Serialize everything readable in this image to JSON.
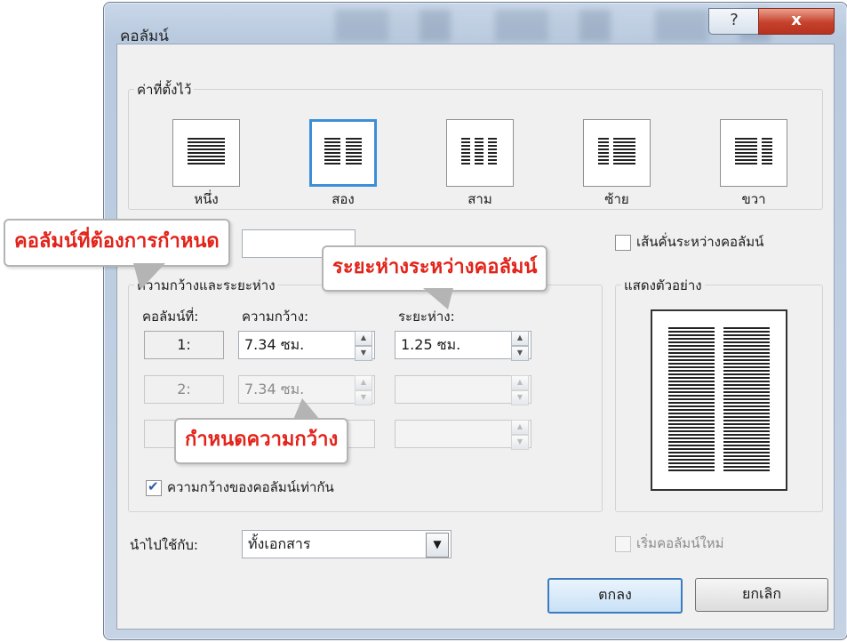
{
  "dialog": {
    "title": "คอลัมน์",
    "help_label": "?",
    "close_label": "x"
  },
  "presets": {
    "legend": "ค่าที่ตั้งไว้",
    "items": [
      {
        "label": "หนึ่ง",
        "icon": "one-column-icon",
        "selected": false
      },
      {
        "label": "สอง",
        "icon": "two-columns-icon",
        "selected": true
      },
      {
        "label": "สาม",
        "icon": "three-columns-icon",
        "selected": false
      },
      {
        "label": "ซ้าย",
        "icon": "left-column-icon",
        "selected": false
      },
      {
        "label": "ขวา",
        "icon": "right-column-icon",
        "selected": false
      }
    ]
  },
  "line_between": {
    "label": "เส้นคั่นระหว่างคอลัมน์",
    "checked": false
  },
  "width_spacing": {
    "legend": "ความกว้างและระยะห่าง",
    "headers": {
      "column": "คอลัมน์ที่:",
      "width": "ความกว้าง:",
      "spacing": "ระยะห่าง:"
    },
    "rows": [
      {
        "num": "1:",
        "width": "7.34 ซม.",
        "spacing": "1.25 ซม.",
        "enabled": true
      },
      {
        "num": "2:",
        "width": "7.34 ซม.",
        "spacing": "",
        "enabled": false
      },
      {
        "num": "",
        "width": "",
        "spacing": "",
        "enabled": false
      }
    ],
    "equal_width": {
      "label": "ความกว้างของคอลัมน์เท่ากัน",
      "checked": true
    }
  },
  "preview": {
    "legend": "แสดงตัวอย่าง"
  },
  "apply_to": {
    "label": "นำไปใช้กับ:",
    "value": "ทั้งเอกสาร"
  },
  "new_column": {
    "label": "เริ่มคอลัมน์ใหม่",
    "checked": false
  },
  "buttons": {
    "ok": "ตกลง",
    "cancel": "ยกเลิก"
  },
  "callouts": {
    "columns": "คอลัมน์ที่ต้องการกำหนด",
    "spacing": "ระยะห่างระหว่างคอลัมน์",
    "width": "กำหนดความกว้าง"
  },
  "colors": {
    "callout_text": "#e2231a",
    "selection": "#3c8fd7",
    "close": "#c6412b"
  }
}
